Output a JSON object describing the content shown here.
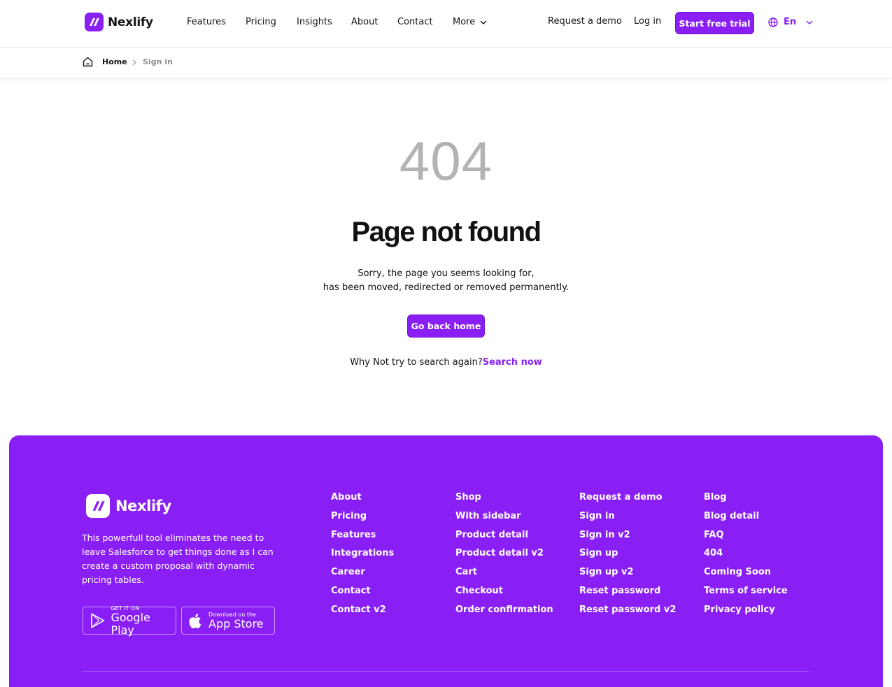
{
  "brand": {
    "name": "Nexlify",
    "accent": "#8a1ff5"
  },
  "nav": {
    "items": [
      "Features",
      "Pricing",
      "Insights",
      "About",
      "Contact",
      "More"
    ],
    "request_demo": "Request a demo",
    "login": "Log in",
    "trial": "Start free trial",
    "lang": "En"
  },
  "breadcrumb": {
    "home": "Home",
    "current": "Sign in"
  },
  "error": {
    "code": "404",
    "title": "Page not found",
    "line1": "Sorry, the page you seems looking for,",
    "line2": "has been moved, redirected or removed permanently.",
    "button": "Go back home",
    "search_prompt": "Why Not try to search again?",
    "search_link": "Search now"
  },
  "footer": {
    "description": "This powerfull tool eliminates the need to leave Salesforce to get things done as I can create a custom proposal with dynamic pricing tables.",
    "google_play": {
      "small": "GET IT ON",
      "big": "Google Play"
    },
    "app_store": {
      "small": "Download on the",
      "big": "App Store"
    },
    "columns": [
      [
        "About",
        "Pricing",
        "Features",
        "Integrations",
        "Career",
        "Contact",
        "Contact v2"
      ],
      [
        "Shop",
        "With sidebar",
        "Product detail",
        "Product detail v2",
        "Cart",
        "Checkout",
        "Order confirmation"
      ],
      [
        "Request a demo",
        "Sign in",
        "Sign in v2",
        "Sign up",
        "Sign up v2",
        "Reset password",
        "Reset password v2"
      ],
      [
        "Blog",
        "Blog detail",
        "FAQ",
        "404",
        "Coming Soon",
        "Terms of service",
        "Privacy policy"
      ]
    ]
  }
}
